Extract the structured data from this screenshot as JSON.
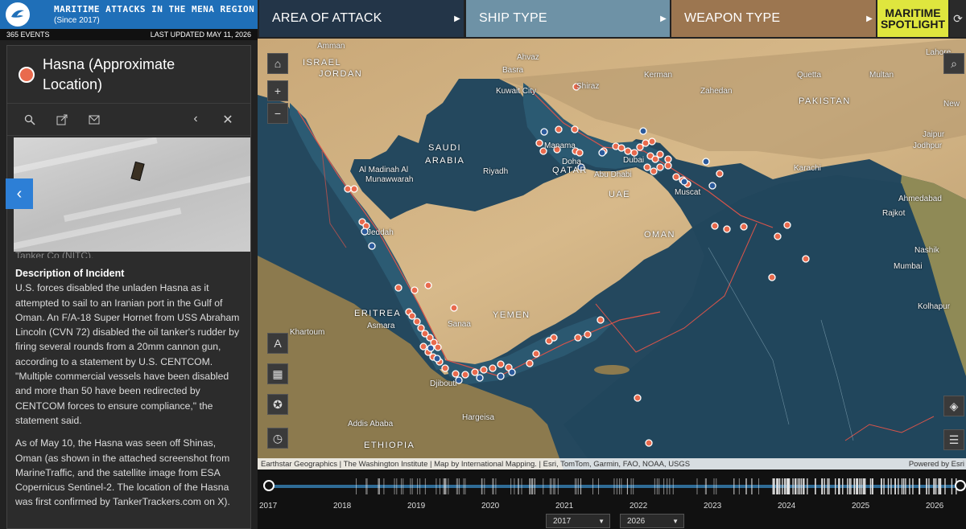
{
  "header": {
    "title": "MARITIME ATTACKS IN THE MENA REGION",
    "subtitle": "(Since 2017)",
    "events": "365 EVENTS",
    "updated": "LAST UPDATED MAY 11, 2026"
  },
  "tabs": {
    "area": "AREA OF ATTACK",
    "ship": "SHIP TYPE",
    "weapon": "WEAPON TYPE",
    "spotlight_line1": "MARITIME",
    "spotlight_line2": "SPOTLIGHT"
  },
  "panel": {
    "title": "Hasna (Approximate Location)",
    "cut_text": "Tanker Co (NITC).",
    "heading": "Description of Incident",
    "p1": "U.S. forces disabled the unladen Hasna as it attempted to sail to an Iranian port in the Gulf of Oman. An F/A-18 Super Hornet from USS Abraham Lincoln (CVN 72) disabled the oil tanker's rudder by firing several rounds from a 20mm cannon gun, according to a statement by U.S. CENTCOM. \"Multiple commercial vessels have been disabled and more than 50 have been redirected by CENTCOM forces to ensure compliance,\" the statement said.",
    "p2": "As of May 10, the Hasna was seen off Shinas, Oman (as shown in the attached screenshot from MarineTraffic, and the satellite image from ESA Copernicus Sentinel-2. The location of the Hasna was first confirmed by TankerTrackers.com on X).",
    "accent_color": "#e96a4d"
  },
  "map": {
    "countries": {
      "israel": "ISRAEL",
      "jordan": "JORDAN",
      "saudi1": "SAUDI",
      "saudi2": "ARABIA",
      "qatar": "QATAR",
      "uae": "UAE",
      "oman": "OMAN",
      "yemen": "YEMEN",
      "eritrea": "ERITREA",
      "ethiopia": "ETHIOPIA",
      "pakistan": "PAKISTAN"
    },
    "cities": {
      "amman": "Amman",
      "ahvaz": "Ahvaz",
      "basra": "Basra",
      "kuwait": "Kuwait City",
      "shiraz": "Shiraz",
      "kerman": "Kerman",
      "zahedan": "Zahedan",
      "quetta": "Quetta",
      "multan": "Multan",
      "lahore": "Lahore",
      "newdelhi": "New",
      "jaipur": "Jaipur",
      "jodhpur": "Jodhpur",
      "karachi": "Karachi",
      "medina1": "Al Madinah Al",
      "medina2": "Munawwarah",
      "riyadh": "Riyadh",
      "jeddah": "Jeddah",
      "manama": "Manama",
      "doha": "Doha",
      "dubai": "Dubai",
      "abudhabi": "Abu Dhabi",
      "muscat": "Muscat",
      "ahmedabad": "Ahmedabad",
      "rajkot": "Rajkot",
      "nashik": "Nashik",
      "mumbai": "Mumbai",
      "kolhapur": "Kolhapur",
      "sanaa": "Sanaa",
      "asmara": "Asmara",
      "khartoum": "Khartoum",
      "djibouti": "Djibouti",
      "hargeisa": "Hargeisa",
      "addis": "Addis Ababa"
    },
    "attribution": "Earthstar Geographics | The Washington Institute | Map by International Mapping. | Esri, TomTom, Garmin, FAO, NOAA, USGS",
    "powered": "Powered by Esri"
  },
  "timeline": {
    "years": [
      "2017",
      "2018",
      "2019",
      "2020",
      "2021",
      "2022",
      "2023",
      "2024",
      "2025",
      "2026"
    ],
    "start": "2017",
    "end": "2026"
  },
  "icons": {
    "search": "search-icon",
    "share": "share-icon",
    "mail": "mail-icon",
    "collapse": "chevron-left-icon",
    "close": "close-icon",
    "home": "home-icon",
    "zoomin": "plus-icon",
    "zoomout": "minus-icon",
    "text": "text-size-icon",
    "qr": "qr-icon",
    "accessibility": "accessibility-icon",
    "history": "clock-icon",
    "layers": "layers-icon",
    "legend": "list-icon",
    "refresh": "refresh-icon"
  }
}
